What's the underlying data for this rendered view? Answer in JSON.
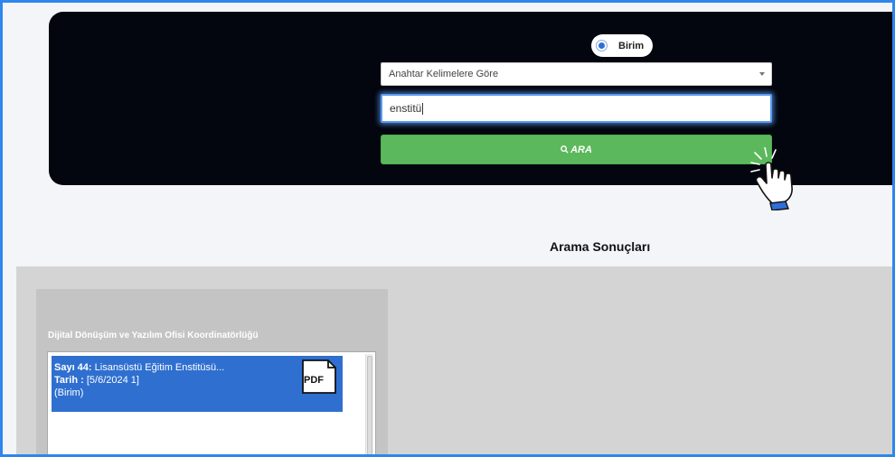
{
  "search": {
    "radio_label": "Birim",
    "select_value": "Anahtar Kelimelere Göre",
    "input_value": "enstitü",
    "button_label": "ARA",
    "button_icon": "search-icon"
  },
  "results": {
    "heading": "Arama Sonuçları",
    "card": {
      "title": "Dijital Dönüşüm ve Yazılım Ofisi Koordinatörlüğü",
      "items": [
        {
          "sayi_label": "Sayı 44:",
          "subject": " Lisansüstü Eğitim Enstitüsü...",
          "tarih_label": "Tarih :",
          "date": " [5/6/2024 1]",
          "unit": "(Birim)",
          "file_icon": "pdf-icon",
          "file_type": "PDF"
        }
      ]
    }
  },
  "colors": {
    "frame_border": "#2f86ee",
    "panel_bg": "#03050f",
    "button_green": "#5cb85c",
    "item_selected": "#2f6fd0"
  }
}
